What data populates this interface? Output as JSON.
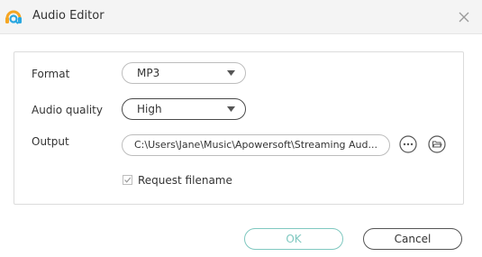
{
  "window": {
    "title": "Audio Editor",
    "logo_icon": "apowersoft-logo-icon",
    "close_icon": "close-icon"
  },
  "form": {
    "format": {
      "label": "Format",
      "value": "MP3"
    },
    "quality": {
      "label": "Audio quality",
      "value": "High"
    },
    "output": {
      "label": "Output",
      "path": "C:\\Users\\Jane\\Music\\Apowersoft\\Streaming Aud...",
      "more_icon": "ellipsis-icon",
      "folder_icon": "folder-open-icon"
    },
    "request_filename": {
      "label": "Request filename",
      "checked": true
    }
  },
  "buttons": {
    "ok_label": "OK",
    "cancel_label": "Cancel"
  },
  "colors": {
    "ok_accent": "#7fc8c0",
    "logo_orange": "#f5a623",
    "logo_blue": "#2aa7e0"
  }
}
